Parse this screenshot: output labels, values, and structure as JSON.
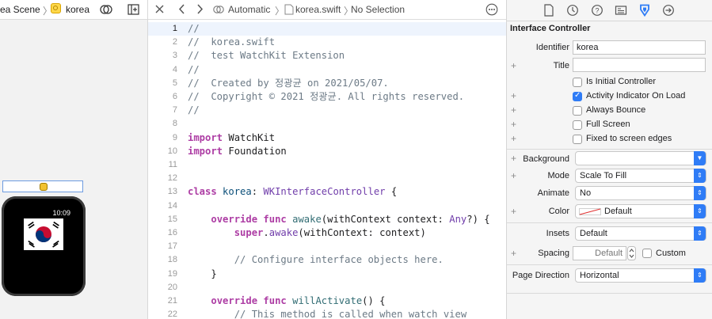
{
  "canvas": {
    "breadcrumb_scene": "rea Scene",
    "breadcrumb_separator": "〉",
    "breadcrumb_controller": "korea",
    "watch_time": "10:09"
  },
  "editor": {
    "jumpbar": {
      "scheme": "Automatic",
      "file": "korea.swift",
      "selection": "No Selection"
    },
    "lines": [
      {
        "n": "1",
        "tokens": [
          {
            "t": "//",
            "c": "c-comment"
          }
        ]
      },
      {
        "n": "2",
        "tokens": [
          {
            "t": "//  korea.swift",
            "c": "c-comment"
          }
        ]
      },
      {
        "n": "3",
        "tokens": [
          {
            "t": "//  test WatchKit Extension",
            "c": "c-comment"
          }
        ]
      },
      {
        "n": "4",
        "tokens": [
          {
            "t": "//",
            "c": "c-comment"
          }
        ]
      },
      {
        "n": "5",
        "tokens": [
          {
            "t": "//  Created by 정광균 on 2021/05/07.",
            "c": "c-comment"
          }
        ]
      },
      {
        "n": "6",
        "tokens": [
          {
            "t": "//  Copyright © 2021 정광균. All rights reserved.",
            "c": "c-comment"
          }
        ]
      },
      {
        "n": "7",
        "tokens": [
          {
            "t": "//",
            "c": "c-comment"
          }
        ]
      },
      {
        "n": "8",
        "tokens": []
      },
      {
        "n": "9",
        "tokens": [
          {
            "t": "import",
            "c": "c-kw"
          },
          {
            "t": " WatchKit",
            "c": ""
          }
        ]
      },
      {
        "n": "10",
        "tokens": [
          {
            "t": "import",
            "c": "c-kw"
          },
          {
            "t": " Foundation",
            "c": ""
          }
        ]
      },
      {
        "n": "11",
        "tokens": []
      },
      {
        "n": "12",
        "tokens": []
      },
      {
        "n": "13",
        "tokens": [
          {
            "t": "class",
            "c": "c-kw"
          },
          {
            "t": " ",
            "c": ""
          },
          {
            "t": "korea",
            "c": "c-cls"
          },
          {
            "t": ": ",
            "c": ""
          },
          {
            "t": "WKInterfaceController",
            "c": "c-type"
          },
          {
            "t": " {",
            "c": ""
          }
        ]
      },
      {
        "n": "14",
        "tokens": []
      },
      {
        "n": "15",
        "tokens": [
          {
            "t": "    ",
            "c": ""
          },
          {
            "t": "override",
            "c": "c-kw"
          },
          {
            "t": " ",
            "c": ""
          },
          {
            "t": "func",
            "c": "c-kw"
          },
          {
            "t": " ",
            "c": ""
          },
          {
            "t": "awake",
            "c": "c-fn"
          },
          {
            "t": "(withContext context: ",
            "c": ""
          },
          {
            "t": "Any",
            "c": "c-type"
          },
          {
            "t": "?) {",
            "c": ""
          }
        ]
      },
      {
        "n": "16",
        "tokens": [
          {
            "t": "        ",
            "c": ""
          },
          {
            "t": "super",
            "c": "c-kw"
          },
          {
            "t": ".",
            "c": ""
          },
          {
            "t": "awake",
            "c": "c-type"
          },
          {
            "t": "(withContext: context)",
            "c": ""
          }
        ]
      },
      {
        "n": "17",
        "tokens": []
      },
      {
        "n": "18",
        "tokens": [
          {
            "t": "        // Configure interface objects here.",
            "c": "c-comment"
          }
        ]
      },
      {
        "n": "19",
        "tokens": [
          {
            "t": "    }",
            "c": ""
          }
        ]
      },
      {
        "n": "20",
        "tokens": []
      },
      {
        "n": "21",
        "tokens": [
          {
            "t": "    ",
            "c": ""
          },
          {
            "t": "override",
            "c": "c-kw"
          },
          {
            "t": " ",
            "c": ""
          },
          {
            "t": "func",
            "c": "c-kw"
          },
          {
            "t": " ",
            "c": ""
          },
          {
            "t": "willActivate",
            "c": "c-fn"
          },
          {
            "t": "() {",
            "c": ""
          }
        ]
      },
      {
        "n": "22",
        "tokens": [
          {
            "t": "        // This method is called when watch view",
            "c": "c-comment"
          }
        ]
      }
    ]
  },
  "inspector": {
    "section_title": "Interface Controller",
    "identifier_label": "Identifier",
    "identifier_value": "korea",
    "title_label": "Title",
    "title_value": "",
    "checkboxes": [
      {
        "label": "Is Initial Controller",
        "checked": false
      },
      {
        "label": "Activity Indicator On Load",
        "checked": true
      },
      {
        "label": "Always Bounce",
        "checked": false
      },
      {
        "label": "Full Screen",
        "checked": false
      },
      {
        "label": "Fixed to screen edges",
        "checked": false
      }
    ],
    "background_label": "Background",
    "background_value": "",
    "mode_label": "Mode",
    "mode_value": "Scale To Fill",
    "animate_label": "Animate",
    "animate_value": "No",
    "color_label": "Color",
    "color_value": "Default",
    "insets_label": "Insets",
    "insets_value": "Default",
    "spacing_label": "Spacing",
    "spacing_placeholder": "Default",
    "custom_label": "Custom",
    "page_direction_label": "Page Direction",
    "page_direction_value": "Horizontal",
    "accent_color": "#2f7cf6"
  }
}
